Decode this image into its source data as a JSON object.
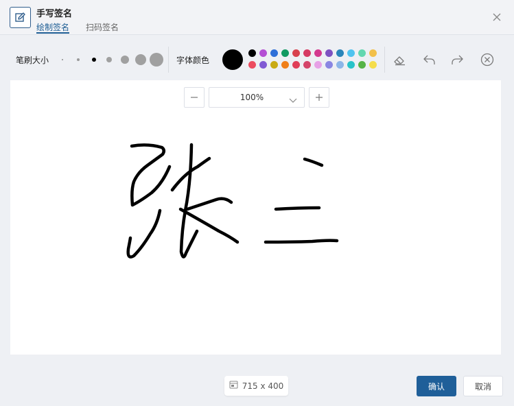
{
  "dialog": {
    "title": "手写签名",
    "tabs": [
      {
        "label": "绘制签名",
        "active": true
      },
      {
        "label": "扫码签名",
        "active": false
      }
    ]
  },
  "toolbar": {
    "brush_label": "笔刷大小",
    "brush_sizes": [
      "1",
      "2",
      "3",
      "4",
      "5",
      "6",
      "7"
    ],
    "selected_brush_size": "3",
    "color_label": "字体颜色",
    "selected_color": "#000000",
    "colors_row1": [
      "#000000",
      "#b44fd4",
      "#2e6fd8",
      "#119a62",
      "#d8414d",
      "#d63a63",
      "#d4398e",
      "#7e52c1",
      "#2a85b9",
      "#4fc3ef",
      "#63d7b0",
      "#f2c04a"
    ],
    "colors_row2": [
      "#ec4c5f",
      "#8059d4",
      "#c9ab14",
      "#f07f1a",
      "#e03e58",
      "#d4456a",
      "#e7a1e6",
      "#8a86e2",
      "#8db6e8",
      "#29c3c9",
      "#56b347",
      "#f5dd4b"
    ],
    "tools": [
      "eraser-icon",
      "undo-icon",
      "redo-icon",
      "clear-icon"
    ]
  },
  "canvas": {
    "zoom_value": "100%",
    "size_label": "715 x 400",
    "signature_text": "张三"
  },
  "footer": {
    "confirm_label": "确认",
    "cancel_label": "取消"
  }
}
